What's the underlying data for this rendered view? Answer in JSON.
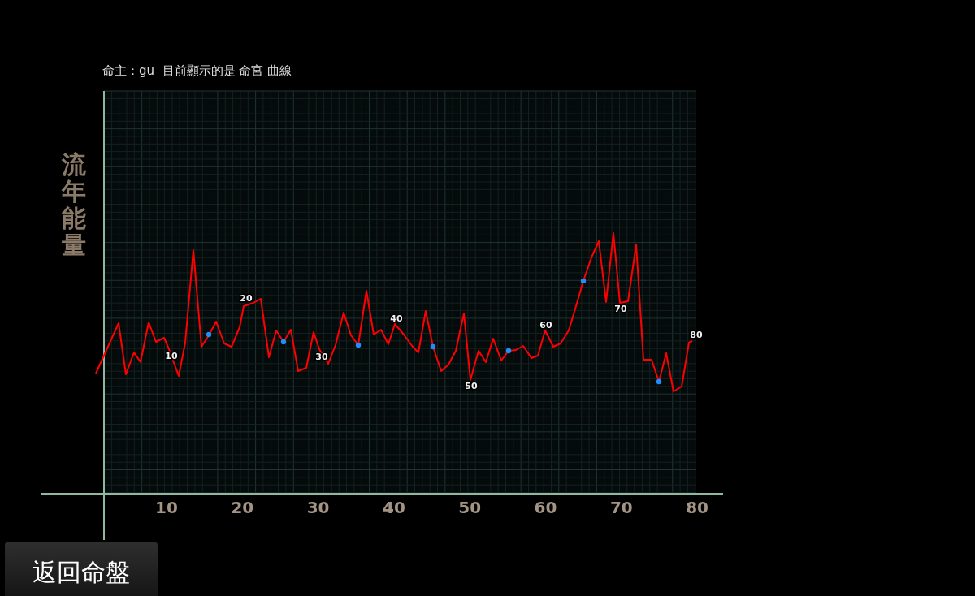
{
  "title": "命主：gu  目前顯示的是 命宮 曲線",
  "y_label": "流年能量",
  "x_ticks": [
    "10",
    "20",
    "30",
    "40",
    "50",
    "60",
    "70",
    "80"
  ],
  "point_labels": [
    "10",
    "20",
    "30",
    "40",
    "50",
    "60",
    "70",
    "80"
  ],
  "back_button": {
    "label": "返回命盤"
  }
}
